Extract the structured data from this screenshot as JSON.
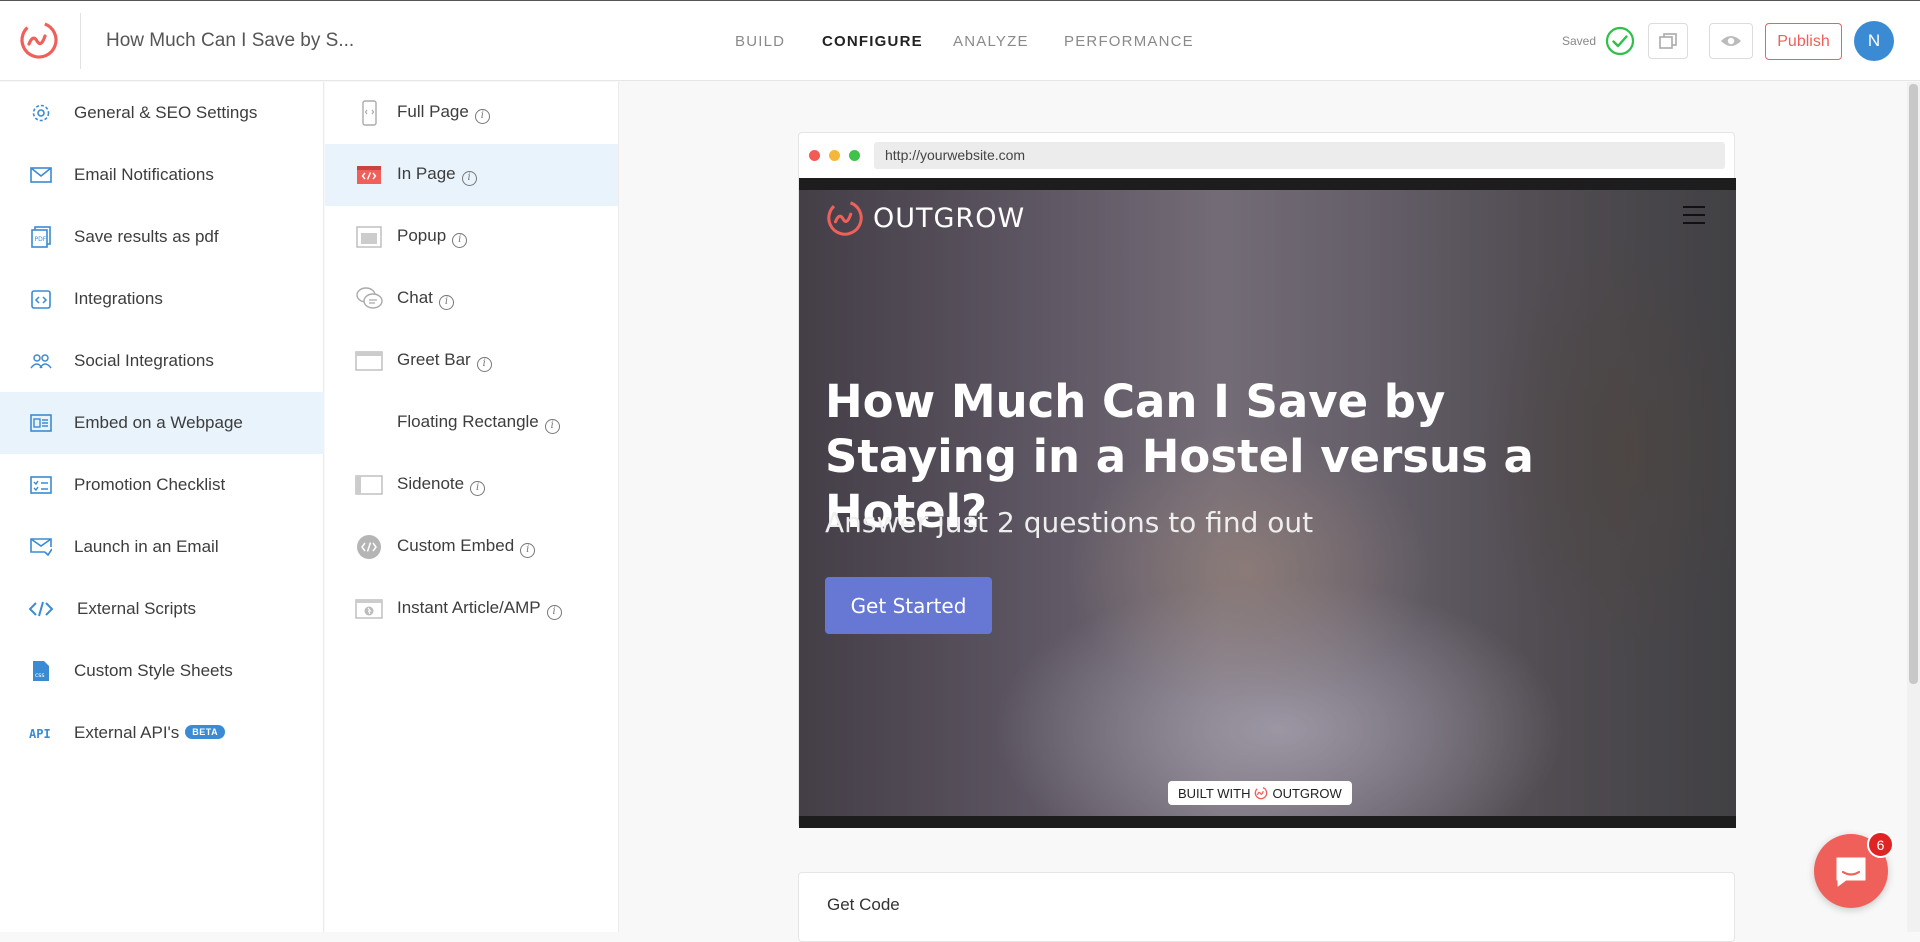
{
  "header": {
    "doc_title": "How Much Can I Save by S...",
    "nav": [
      "BUILD",
      "CONFIGURE",
      "ANALYZE",
      "PERFORMANCE"
    ],
    "active_nav": "CONFIGURE",
    "saved_label": "Saved",
    "publish_label": "Publish",
    "avatar_initial": "N"
  },
  "sidebar": {
    "items": [
      {
        "label": "General & SEO Settings",
        "icon": "gear-icon"
      },
      {
        "label": "Email Notifications",
        "icon": "envelope-icon"
      },
      {
        "label": "Save results as pdf",
        "icon": "pdf-icon"
      },
      {
        "label": "Integrations",
        "icon": "integrations-icon"
      },
      {
        "label": "Social Integrations",
        "icon": "users-icon"
      },
      {
        "label": "Embed on a Webpage",
        "icon": "embed-icon",
        "active": true
      },
      {
        "label": "Promotion Checklist",
        "icon": "checklist-icon"
      },
      {
        "label": "Launch in an Email",
        "icon": "mail-send-icon"
      },
      {
        "label": "External Scripts",
        "icon": "code-icon"
      },
      {
        "label": "Custom Style Sheets",
        "icon": "css-icon"
      },
      {
        "label": "External API's",
        "icon": "api-icon",
        "badge": "BETA"
      }
    ]
  },
  "embed_types": {
    "items": [
      {
        "label": "Full Page",
        "icon": "full-page-icon"
      },
      {
        "label": "In Page",
        "icon": "in-page-icon",
        "active": true
      },
      {
        "label": "Popup",
        "icon": "popup-icon"
      },
      {
        "label": "Chat",
        "icon": "chat-icon"
      },
      {
        "label": "Greet Bar",
        "icon": "greet-bar-icon"
      },
      {
        "label": "Floating Rectangle",
        "icon": ""
      },
      {
        "label": "Sidenote",
        "icon": "sidenote-icon"
      },
      {
        "label": "Custom Embed",
        "icon": "custom-embed-icon"
      },
      {
        "label": "Instant Article/AMP",
        "icon": "amp-icon"
      }
    ]
  },
  "preview": {
    "url": "http://yourwebsite.com",
    "brand": "OUTGROW",
    "title": "How Much Can I Save by Staying in a Hostel versus a Hotel?",
    "subtitle": "Answer just 2 questions to find out",
    "cta": "Get Started",
    "built_with_prefix": "BUILT WITH",
    "built_with_brand": "OUTGROW"
  },
  "get_code": {
    "label": "Get Code"
  },
  "chat_widget": {
    "badge_count": "6"
  },
  "colors": {
    "brand": "#f0605a",
    "accent": "#3a8bd4",
    "cta": "#6777d4",
    "active_bg": "#e8f3fb"
  }
}
